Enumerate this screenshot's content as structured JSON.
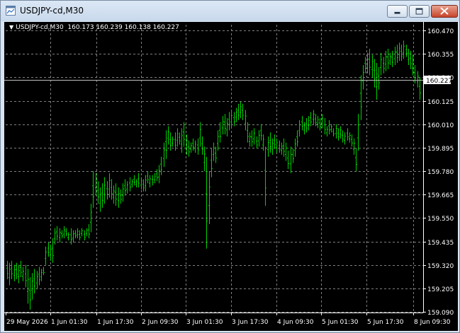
{
  "window": {
    "title": "USDJPY-cd,M30",
    "icons": {
      "app": "chart-window-icon",
      "minimize": "minimize-icon",
      "maximize": "maximize-icon",
      "close": "close-icon"
    }
  },
  "chart_header": {
    "arrow": "▼",
    "symbol": "USDJPY-cd,M30",
    "ohlc": "160.173 160.239 160.138 160.227"
  },
  "colors": {
    "background": "#000000",
    "bars": "#00d000",
    "grid": "#7f7f7f",
    "axis": "#ffffff",
    "bid_line": "#c0c0c0",
    "bid_tag_bg": "#ffffff",
    "bid_tag_text": "#000000"
  },
  "chart_data": {
    "type": "ohlc-bar",
    "ylim": [
      159.09,
      160.47
    ],
    "yticks": [
      "160.470",
      "160.355",
      "160.240",
      "160.125",
      "160.010",
      "159.895",
      "159.780",
      "159.665",
      "159.550",
      "159.435",
      "159.320",
      "159.205",
      "159.090"
    ],
    "xticks": [
      "29 May 2026",
      "1 Jun 01:30",
      "1 Jun 17:30",
      "2 Jun 09:30",
      "3 Jun 01:30",
      "3 Jun 17:30",
      "4 Jun 09:30",
      "5 Jun 01:30",
      "5 Jun 17:30",
      "8 Jun 09:30"
    ],
    "bid_price": "160.227",
    "bid_value": 160.227,
    "grid": true,
    "series": [
      {
        "values": [
          [
            159.34,
            159.25
          ],
          [
            159.33,
            159.22
          ],
          [
            159.34,
            159.25
          ],
          [
            159.32,
            159.24
          ],
          [
            159.33,
            159.25
          ],
          [
            159.32,
            159.23
          ],
          [
            159.34,
            159.26
          ],
          [
            159.31,
            159.24
          ],
          [
            159.32,
            159.21
          ],
          [
            159.3,
            159.13
          ],
          [
            159.26,
            159.1
          ],
          [
            159.28,
            159.15
          ],
          [
            159.3,
            159.18
          ],
          [
            159.29,
            159.2
          ],
          [
            159.31,
            159.22
          ],
          [
            159.3,
            159.24
          ],
          [
            159.31,
            159.27
          ],
          [
            159.41,
            159.32
          ],
          [
            159.43,
            159.36
          ],
          [
            159.42,
            159.34
          ],
          [
            159.45,
            159.33
          ],
          [
            159.5,
            159.42
          ],
          [
            159.51,
            159.44
          ],
          [
            159.5,
            159.43
          ],
          [
            159.49,
            159.45
          ],
          [
            159.51,
            159.45
          ],
          [
            159.5,
            159.46
          ],
          [
            159.48,
            159.44
          ],
          [
            159.5,
            159.42
          ],
          [
            159.49,
            159.43
          ],
          [
            159.49,
            159.45
          ],
          [
            159.5,
            159.45
          ],
          [
            159.49,
            159.44
          ],
          [
            159.5,
            159.46
          ],
          [
            159.49,
            159.44
          ],
          [
            159.5,
            159.46
          ],
          [
            159.52,
            159.45
          ],
          [
            159.62,
            159.48
          ],
          [
            159.78,
            159.6
          ],
          [
            159.77,
            159.66
          ],
          [
            159.73,
            159.62
          ],
          [
            159.7,
            159.58
          ],
          [
            159.72,
            159.6
          ],
          [
            159.75,
            159.62
          ],
          [
            159.73,
            159.64
          ],
          [
            159.77,
            159.65
          ],
          [
            159.74,
            159.64
          ],
          [
            159.71,
            159.62
          ],
          [
            159.72,
            159.61
          ],
          [
            159.7,
            159.6
          ],
          [
            159.69,
            159.62
          ],
          [
            159.72,
            159.63
          ],
          [
            159.74,
            159.66
          ],
          [
            159.73,
            159.67
          ],
          [
            159.75,
            159.68
          ],
          [
            159.74,
            159.7
          ],
          [
            159.76,
            159.71
          ],
          [
            159.74,
            159.7
          ],
          [
            159.77,
            159.7
          ],
          [
            159.75,
            159.69
          ],
          [
            159.74,
            159.68
          ],
          [
            159.76,
            159.68
          ],
          [
            159.78,
            159.72
          ],
          [
            159.76,
            159.7
          ],
          [
            159.76,
            159.71
          ],
          [
            159.77,
            159.72
          ],
          [
            159.79,
            159.73
          ],
          [
            159.81,
            159.72
          ],
          [
            159.85,
            159.76
          ],
          [
            159.92,
            159.8
          ],
          [
            159.98,
            159.84
          ],
          [
            160.0,
            159.91
          ],
          [
            159.97,
            159.88
          ],
          [
            159.95,
            159.9
          ],
          [
            159.97,
            159.88
          ],
          [
            159.99,
            159.9
          ],
          [
            159.97,
            159.91
          ],
          [
            159.99,
            159.87
          ],
          [
            160.02,
            159.9
          ],
          [
            159.96,
            159.86
          ],
          [
            159.93,
            159.85
          ],
          [
            159.92,
            159.87
          ],
          [
            159.94,
            159.88
          ],
          [
            159.93,
            159.87
          ],
          [
            159.94,
            159.86
          ],
          [
            160.02,
            159.9
          ],
          [
            159.95,
            159.86
          ],
          [
            159.9,
            159.78
          ],
          [
            159.85,
            159.4
          ],
          [
            159.78,
            159.52
          ],
          [
            159.89,
            159.75
          ],
          [
            159.92,
            159.83
          ],
          [
            159.9,
            159.82
          ],
          [
            159.98,
            159.88
          ],
          [
            160.02,
            159.92
          ],
          [
            160.05,
            159.96
          ],
          [
            160.06,
            159.96
          ],
          [
            160.04,
            159.95
          ],
          [
            160.07,
            159.98
          ],
          [
            160.08,
            159.99
          ],
          [
            160.07,
            160.0
          ],
          [
            160.09,
            160.02
          ],
          [
            160.11,
            160.03
          ],
          [
            160.12,
            160.04
          ],
          [
            160.11,
            160.03
          ],
          [
            160.08,
            159.98
          ],
          [
            160.02,
            159.92
          ],
          [
            159.97,
            159.9
          ],
          [
            159.98,
            159.9
          ],
          [
            159.99,
            159.91
          ],
          [
            159.95,
            159.89
          ],
          [
            159.98,
            159.9
          ],
          [
            160.01,
            159.93
          ],
          [
            159.96,
            159.88
          ],
          [
            159.9,
            159.61
          ],
          [
            159.95,
            159.85
          ],
          [
            159.97,
            159.87
          ],
          [
            159.94,
            159.86
          ],
          [
            159.96,
            159.89
          ],
          [
            159.94,
            159.87
          ],
          [
            159.93,
            159.87
          ],
          [
            159.92,
            159.86
          ],
          [
            159.94,
            159.85
          ],
          [
            159.92,
            159.83
          ],
          [
            159.88,
            159.79
          ],
          [
            159.9,
            159.77
          ],
          [
            159.89,
            159.82
          ],
          [
            159.94,
            159.85
          ],
          [
            159.98,
            159.9
          ],
          [
            160.03,
            159.95
          ],
          [
            160.05,
            159.98
          ],
          [
            160.02,
            159.96
          ],
          [
            160.04,
            159.97
          ],
          [
            160.05,
            159.98
          ],
          [
            160.07,
            160.0
          ],
          [
            160.08,
            160.01
          ],
          [
            160.06,
            160.0
          ],
          [
            160.05,
            159.99
          ],
          [
            160.04,
            159.98
          ],
          [
            160.06,
            159.99
          ],
          [
            160.04,
            159.96
          ],
          [
            160.0,
            159.95
          ],
          [
            160.03,
            159.96
          ],
          [
            160.01,
            159.97
          ],
          [
            159.99,
            159.95
          ],
          [
            160.01,
            159.94
          ],
          [
            159.99,
            159.93
          ],
          [
            160.0,
            159.94
          ],
          [
            159.98,
            159.92
          ],
          [
            159.97,
            159.91
          ],
          [
            159.99,
            159.93
          ],
          [
            159.97,
            159.92
          ],
          [
            159.96,
            159.9
          ],
          [
            159.94,
            159.86
          ],
          [
            159.89,
            159.78
          ],
          [
            160.06,
            159.88
          ],
          [
            160.25,
            160.03
          ],
          [
            160.3,
            160.18
          ],
          [
            160.34,
            160.26
          ],
          [
            160.36,
            160.26
          ],
          [
            160.38,
            160.25
          ],
          [
            160.35,
            160.24
          ],
          [
            160.33,
            160.19
          ],
          [
            160.31,
            160.13
          ],
          [
            160.29,
            160.18
          ],
          [
            160.36,
            160.25
          ],
          [
            160.34,
            160.26
          ],
          [
            160.37,
            160.27
          ],
          [
            160.38,
            160.28
          ],
          [
            160.36,
            160.3
          ],
          [
            160.37,
            160.29
          ],
          [
            160.39,
            160.3
          ],
          [
            160.4,
            160.31
          ],
          [
            160.41,
            160.32
          ],
          [
            160.4,
            160.32
          ],
          [
            160.42,
            160.33
          ],
          [
            160.4,
            160.34
          ],
          [
            160.38,
            160.3
          ],
          [
            160.37,
            160.28
          ],
          [
            160.35,
            160.25
          ],
          [
            160.3,
            160.21
          ],
          [
            160.27,
            160.19
          ],
          [
            160.24,
            160.13
          ]
        ]
      }
    ]
  }
}
